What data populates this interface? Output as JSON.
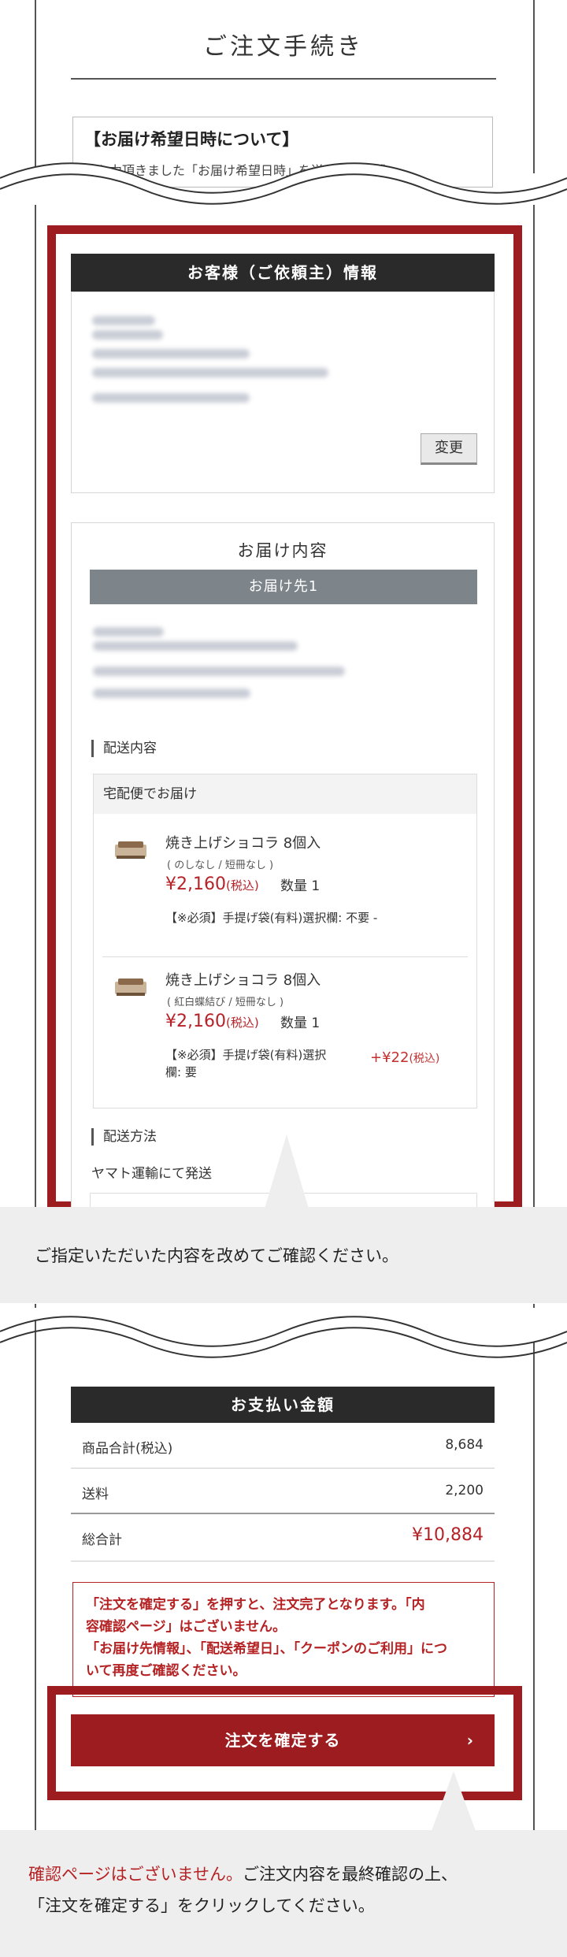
{
  "header": {
    "title": "ご注文手続き"
  },
  "notice": {
    "title": "【お届け希望日時について】",
    "text": "ご入力頂きました「お届け希望日時」を送り状に記載"
  },
  "customer": {
    "header": "お客様（ご依頼主）情報",
    "change_label": "変更"
  },
  "delivery": {
    "title": "お届け内容",
    "destination_label": "お届け先1",
    "contents_label": "配送内容",
    "courier_label": "宅配便でお届け",
    "items": [
      {
        "name": "焼き上げショコラ 8個入",
        "sub": "( のしなし / 短冊なし )",
        "price": "¥2,160",
        "tax": "(税込)",
        "qty": "数量 1",
        "option": "【※必須】手提げ袋(有料)選択欄: 不要 -"
      },
      {
        "name": "焼き上げショコラ 8個入",
        "sub": "( 紅白蝶結び / 短冊なし )",
        "price": "¥2,160",
        "tax": "(税込)",
        "qty": "数量 1",
        "option_line1": "【※必須】手提げ袋(有料)選択",
        "option_line2": "欄: 要",
        "option_price": "+¥22",
        "option_tax": "(税込)"
      }
    ],
    "method_label": "配送方法",
    "method_value": "ヤマト運輸にて発送"
  },
  "callout1": {
    "text": "ご指定いただいた内容を改めてご確認ください。"
  },
  "payment": {
    "header": "お支払い金額",
    "rows": [
      {
        "label": "商品合計(税込)",
        "value": "8,684"
      },
      {
        "label": "送料",
        "value": "2,200"
      },
      {
        "label": "総合計",
        "value": "¥10,884"
      }
    ]
  },
  "warning": {
    "line1": "「注文を確定する」を押すと、注文完了となります。「内",
    "line2": "容確認ページ」はございません。",
    "line3": "「お届け先情報」、「配送希望日」、「クーポンのご利用」につ",
    "line4": "いて再度ご確認ください。"
  },
  "confirm_button": {
    "label": "注文を確定する",
    "arrow": "›"
  },
  "callout2": {
    "red_text": "確認ページはございません。",
    "text1": "ご注文内容を最終確認の上、",
    "text2": "「注文を確定する」をクリックしてください。"
  },
  "colors": {
    "accent": "#9c1c1f",
    "dark_bar": "#2a2a2a",
    "gray_bar": "#7d848a",
    "price_red": "#b52228"
  }
}
